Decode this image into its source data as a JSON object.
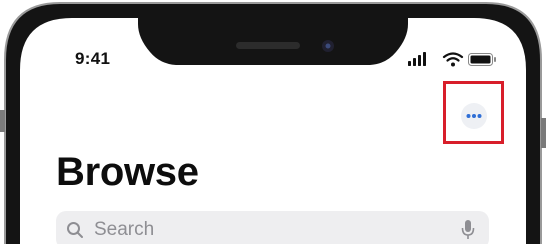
{
  "status_bar": {
    "time": "9:41",
    "icons": [
      "cellular-signal-icon",
      "wifi-icon",
      "battery-icon"
    ]
  },
  "header": {
    "more_button_icon": "ellipsis-icon",
    "title": "Browse"
  },
  "search": {
    "placeholder": "Search",
    "icons": [
      "magnifier-icon",
      "microphone-icon"
    ]
  },
  "colors": {
    "accent": "#2f6fd6",
    "highlight": "#d81e2a"
  }
}
